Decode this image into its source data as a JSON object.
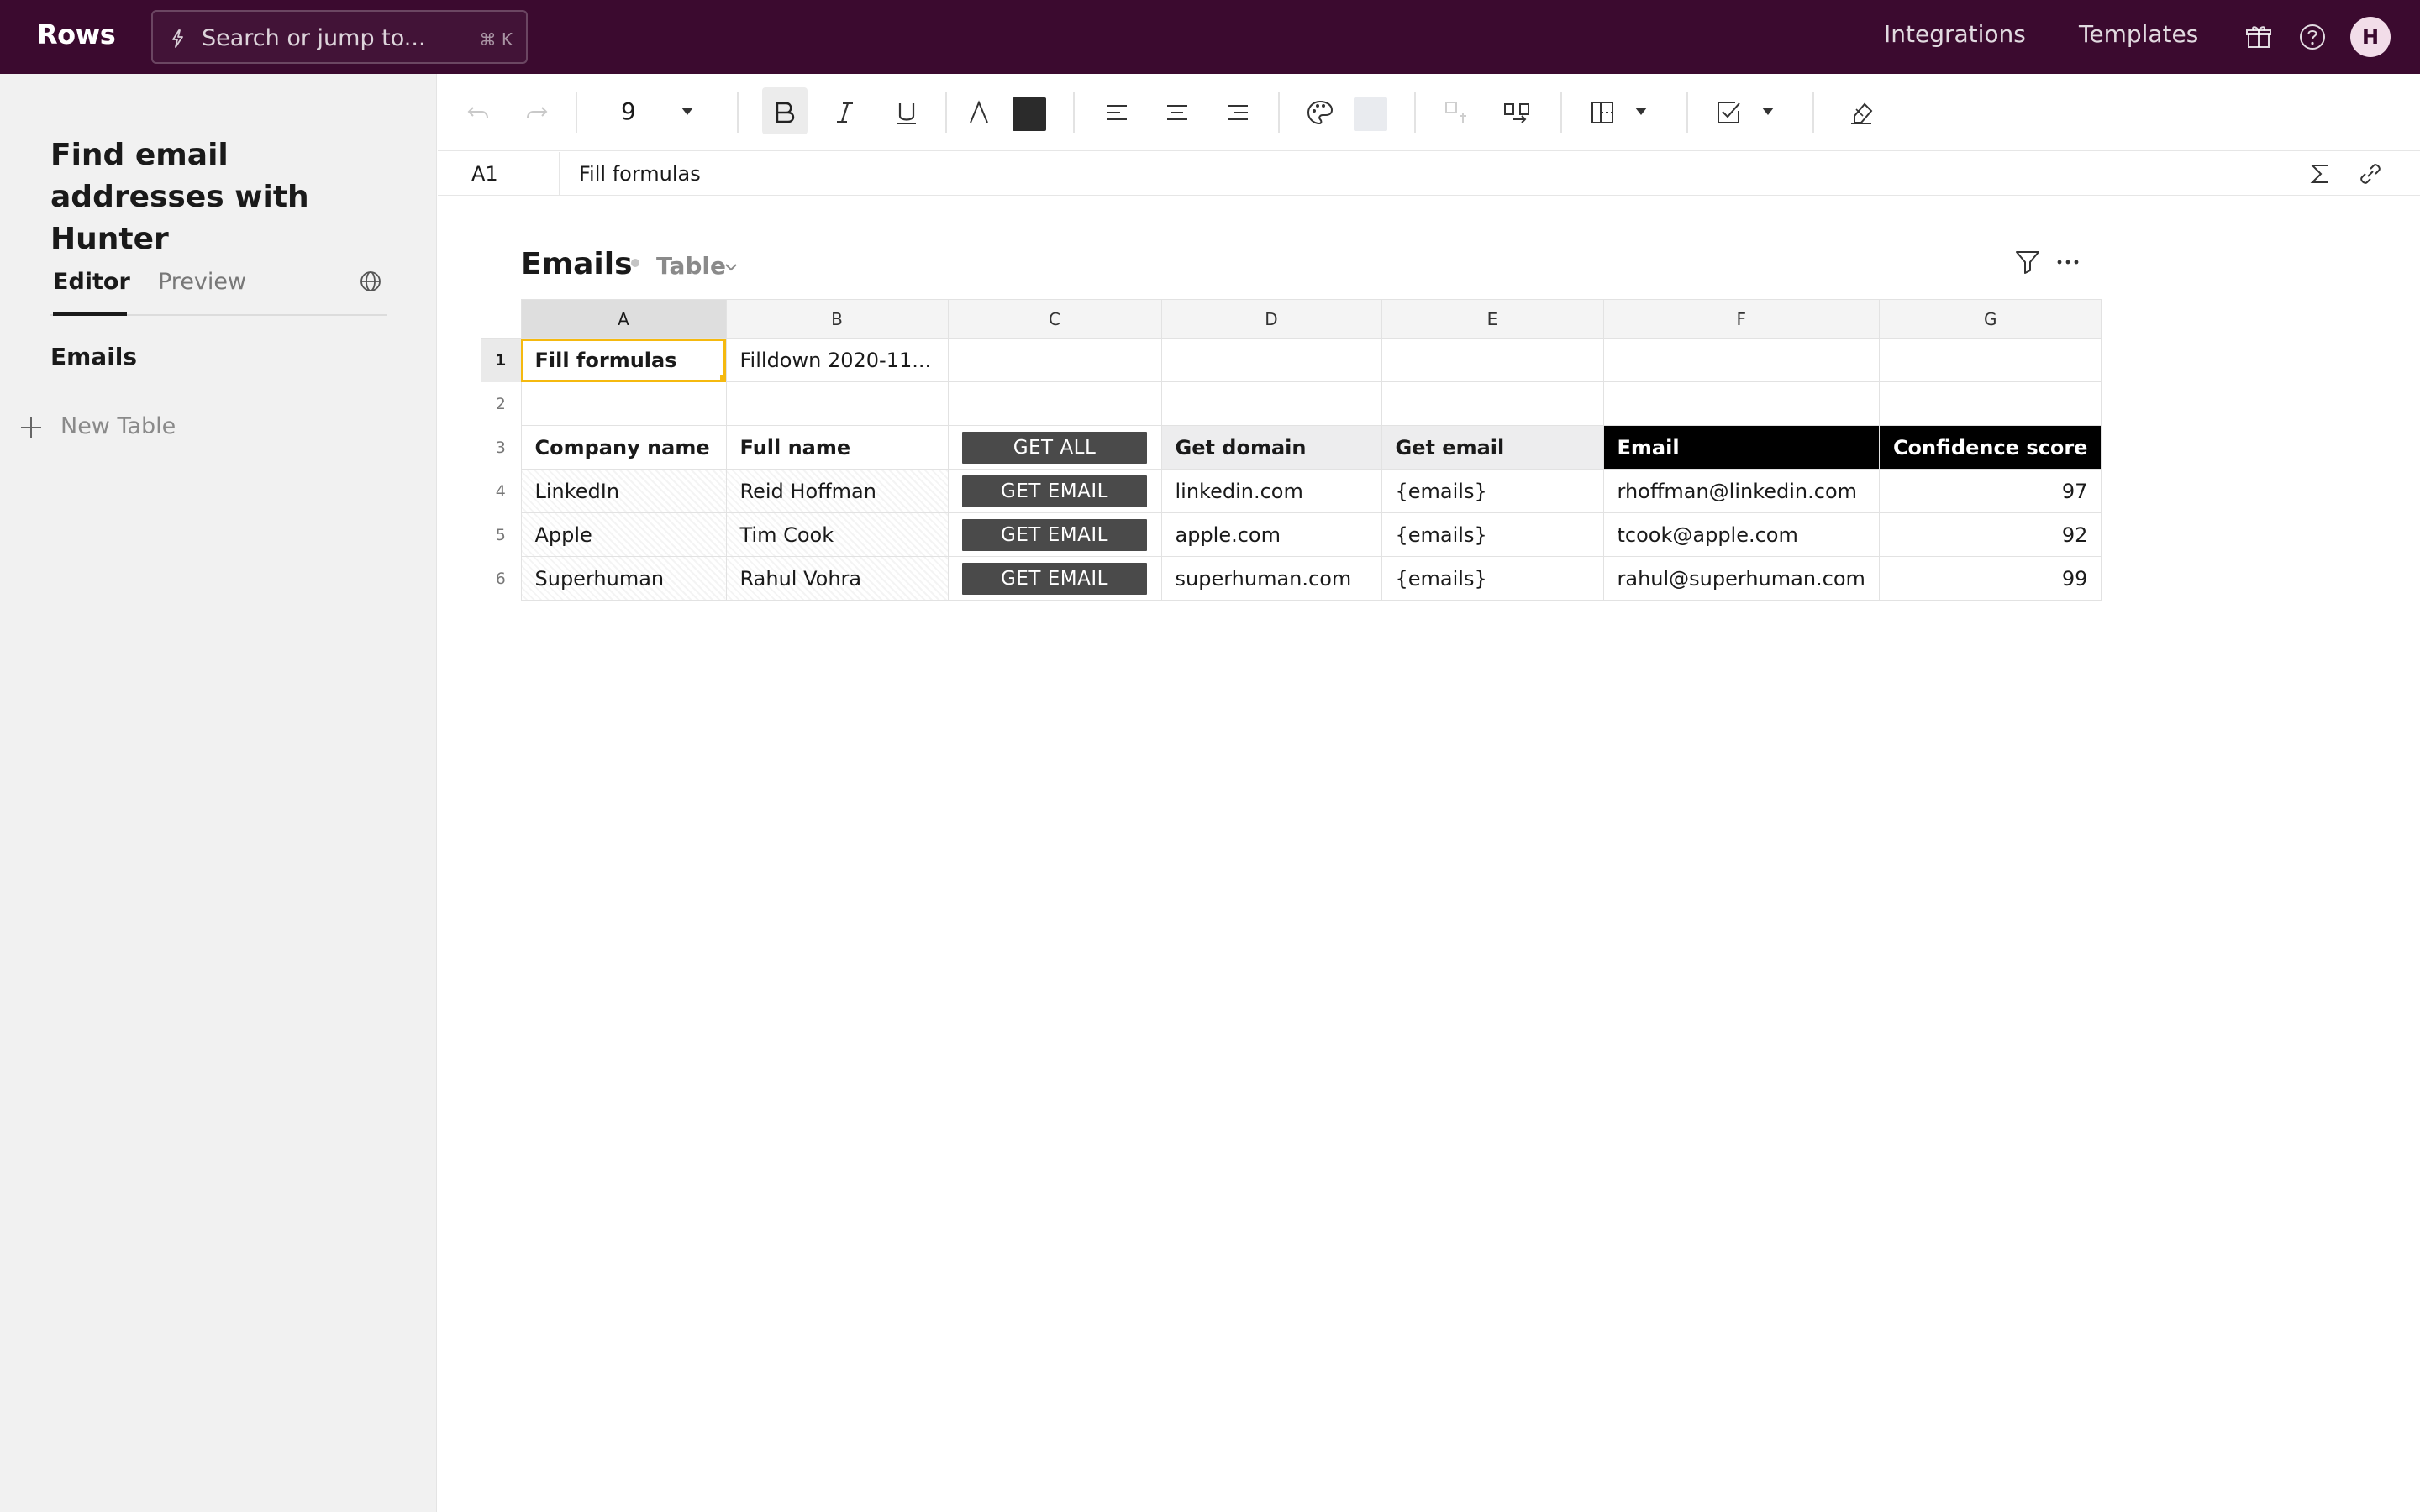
{
  "app": {
    "logo": "Rows",
    "search_placeholder": "Search or jump to...",
    "search_shortcut": "⌘ K",
    "nav": {
      "integrations": "Integrations",
      "templates": "Templates"
    },
    "avatar_initial": "H"
  },
  "sidebar": {
    "doc_title": "Find email addresses with Hunter",
    "tabs": {
      "editor": "Editor",
      "preview": "Preview"
    },
    "tables": [
      "Emails"
    ],
    "new_table_label": "New Table"
  },
  "toolbar": {
    "font_size": "9",
    "text_color": "#2b2b2b",
    "fill_color": "#e9ebef"
  },
  "formula_bar": {
    "cell_ref": "A1",
    "formula": "Fill formulas"
  },
  "table": {
    "title": "Emails",
    "type": "Table",
    "columns": [
      "A",
      "B",
      "C",
      "D",
      "E",
      "F",
      "G"
    ],
    "row_numbers": [
      "1",
      "2",
      "3",
      "4",
      "5",
      "6"
    ],
    "row1": {
      "a": "Fill formulas",
      "b": "Filldown 2020-11..."
    },
    "headers": {
      "company": "Company name",
      "full_name": "Full name",
      "get_all": "GET ALL",
      "get_domain": "Get domain",
      "get_email": "Get email",
      "email": "Email",
      "confidence": "Confidence score"
    },
    "rows": [
      {
        "company": "LinkedIn",
        "name": "Reid Hoffman",
        "button": "GET EMAIL",
        "domain": "linkedin.com",
        "emails": "{emails}",
        "email": "rhoffman@linkedin.com",
        "score": "97"
      },
      {
        "company": "Apple",
        "name": "Tim Cook",
        "button": "GET EMAIL",
        "domain": "apple.com",
        "emails": "{emails}",
        "email": "tcook@apple.com",
        "score": "92"
      },
      {
        "company": "Superhuman",
        "name": "Rahul Vohra",
        "button": "GET EMAIL",
        "domain": "superhuman.com",
        "emails": "{emails}",
        "email": "rahul@superhuman.com",
        "score": "99"
      }
    ]
  },
  "colors": {
    "topbar": "#3b0a2f",
    "selection": "#f5b90f",
    "black_header": "#000000",
    "button": "#4a4a4a"
  }
}
